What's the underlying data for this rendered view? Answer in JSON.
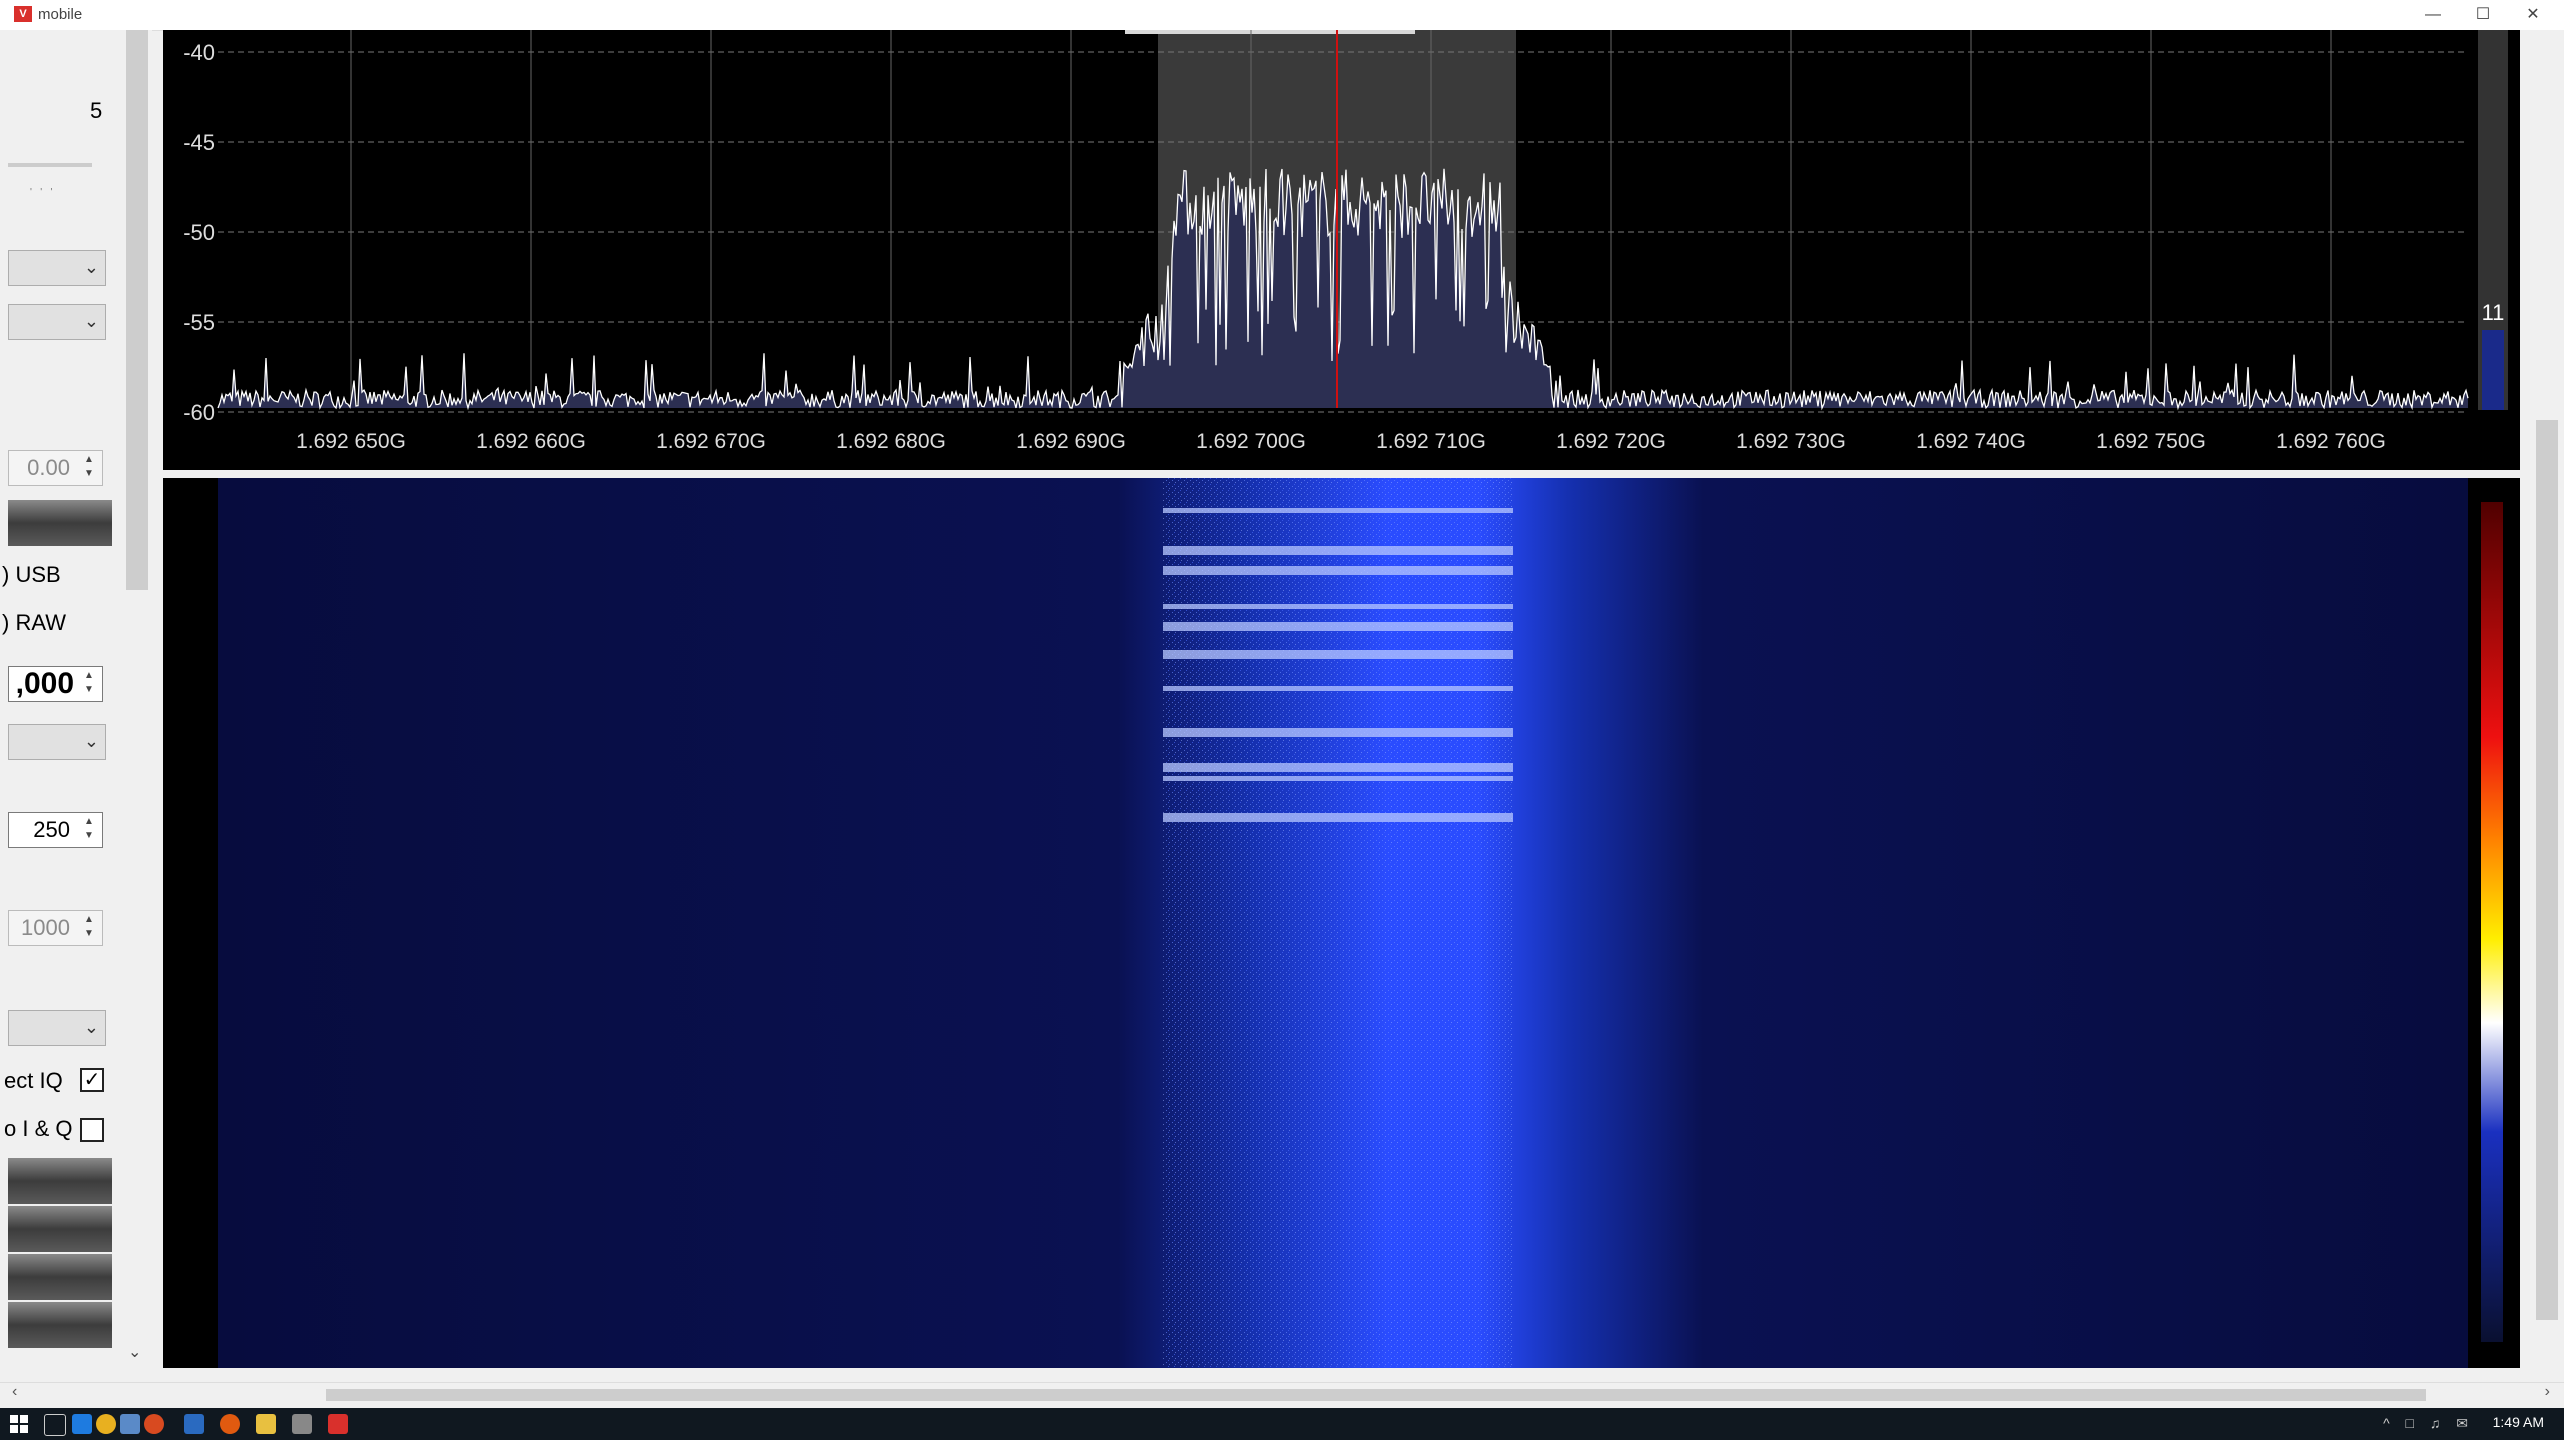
{
  "window": {
    "title": "mobile",
    "app_icon": "V"
  },
  "left_panel": {
    "value_top": "5",
    "spin_offset": "0.00",
    "radio_usb": "USB",
    "radio_raw": "RAW",
    "spin_freq": ",000",
    "spin_250": "250",
    "spin_1000": "1000",
    "check_correct_iq": "ect IQ",
    "check_swap_iq": "o I & Q"
  },
  "spectrum": {
    "y_ticks": [
      "-40",
      "-45",
      "-50",
      "-55",
      "-60"
    ],
    "x_ticks": [
      "1.692 650G",
      "1.692 660G",
      "1.692 670G",
      "1.692 680G",
      "1.692 690G",
      "1.692 700G",
      "1.692 710G",
      "1.692 720G",
      "1.692 730G",
      "1.692 740G",
      "1.692 750G",
      "1.692 760G"
    ],
    "level_value": "11"
  },
  "taskbar": {
    "clock": "1:49 AM"
  },
  "colors": {
    "spectrum_bg": "#000000",
    "filter_band": "#3a3a3a",
    "center_line": "#d01010",
    "waterfall_bg": "#0a0f4a",
    "signal_blue": "#2a4cff"
  }
}
